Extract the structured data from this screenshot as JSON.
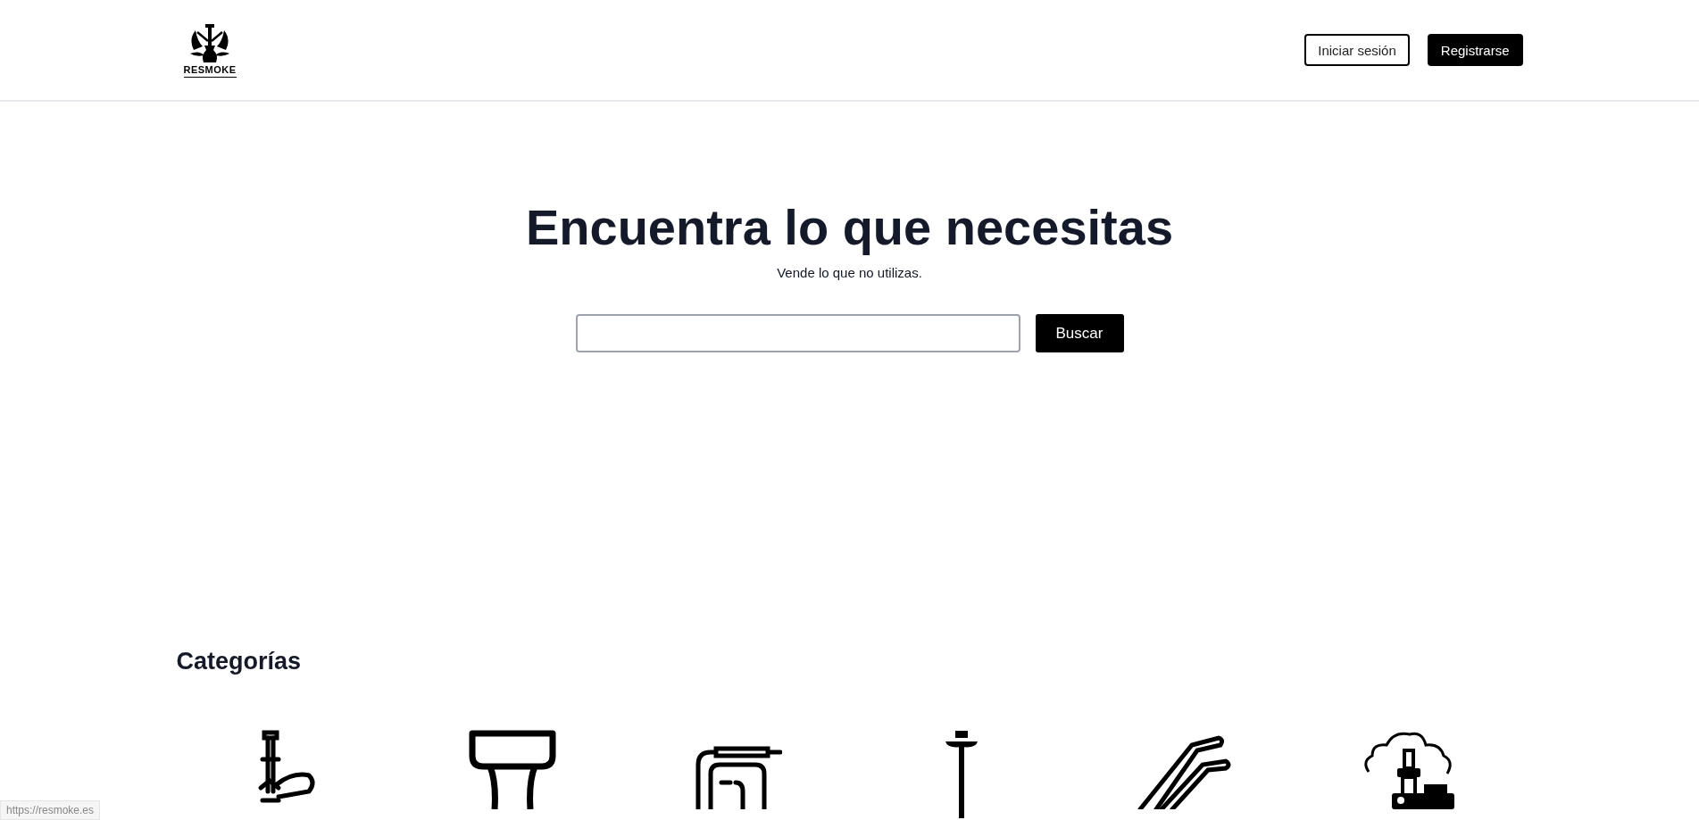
{
  "header": {
    "logo_text": "RESMOKE",
    "buttons": [
      {
        "label": "Iniciar sesión",
        "kind": "outline"
      },
      {
        "label": "Registrarse",
        "kind": "solid"
      }
    ]
  },
  "hero": {
    "title": "Encuentra lo que necesitas",
    "subtitle": "Vende lo que no utilizas.",
    "search_button": "Buscar"
  },
  "categories": {
    "title": "Categorías"
  },
  "status_bar": {
    "url": "https://resmoke.es"
  }
}
